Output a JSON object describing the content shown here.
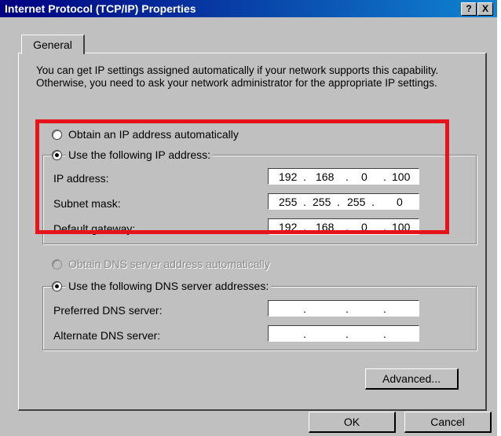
{
  "window": {
    "title": "Internet Protocol (TCP/IP) Properties",
    "help_label": "?",
    "close_label": "X"
  },
  "tabs": [
    {
      "label": "General",
      "selected": true
    }
  ],
  "description": "You can get IP settings assigned automatically if your network supports this capability. Otherwise, you need to ask your network administrator for the appropriate IP settings.",
  "ip_settings": {
    "auto_label": "Obtain an IP address automatically",
    "manual_label": "Use the following IP address:",
    "selected": "manual",
    "fields": [
      {
        "label": "IP address:",
        "octets": [
          "192",
          "168",
          "0",
          "100"
        ]
      },
      {
        "label": "Subnet mask:",
        "octets": [
          "255",
          "255",
          "255",
          "0"
        ]
      },
      {
        "label": "Default gateway:",
        "octets": [
          "192",
          "168",
          "0",
          "100"
        ]
      }
    ]
  },
  "dns_settings": {
    "auto_label": "Obtain DNS server address automatically",
    "manual_label": "Use the following DNS server addresses:",
    "selected": "manual",
    "auto_disabled": true,
    "fields": [
      {
        "label": "Preferred DNS server:",
        "octets": [
          "",
          "",
          "",
          ""
        ]
      },
      {
        "label": "Alternate DNS server:",
        "octets": [
          "",
          "",
          "",
          ""
        ]
      }
    ]
  },
  "buttons": {
    "advanced": "Advanced...",
    "ok": "OK",
    "cancel": "Cancel"
  },
  "colors": {
    "title_bar": "#000080",
    "dialog_bg": "#c0c0c0",
    "highlight_box": "#e8131a"
  }
}
